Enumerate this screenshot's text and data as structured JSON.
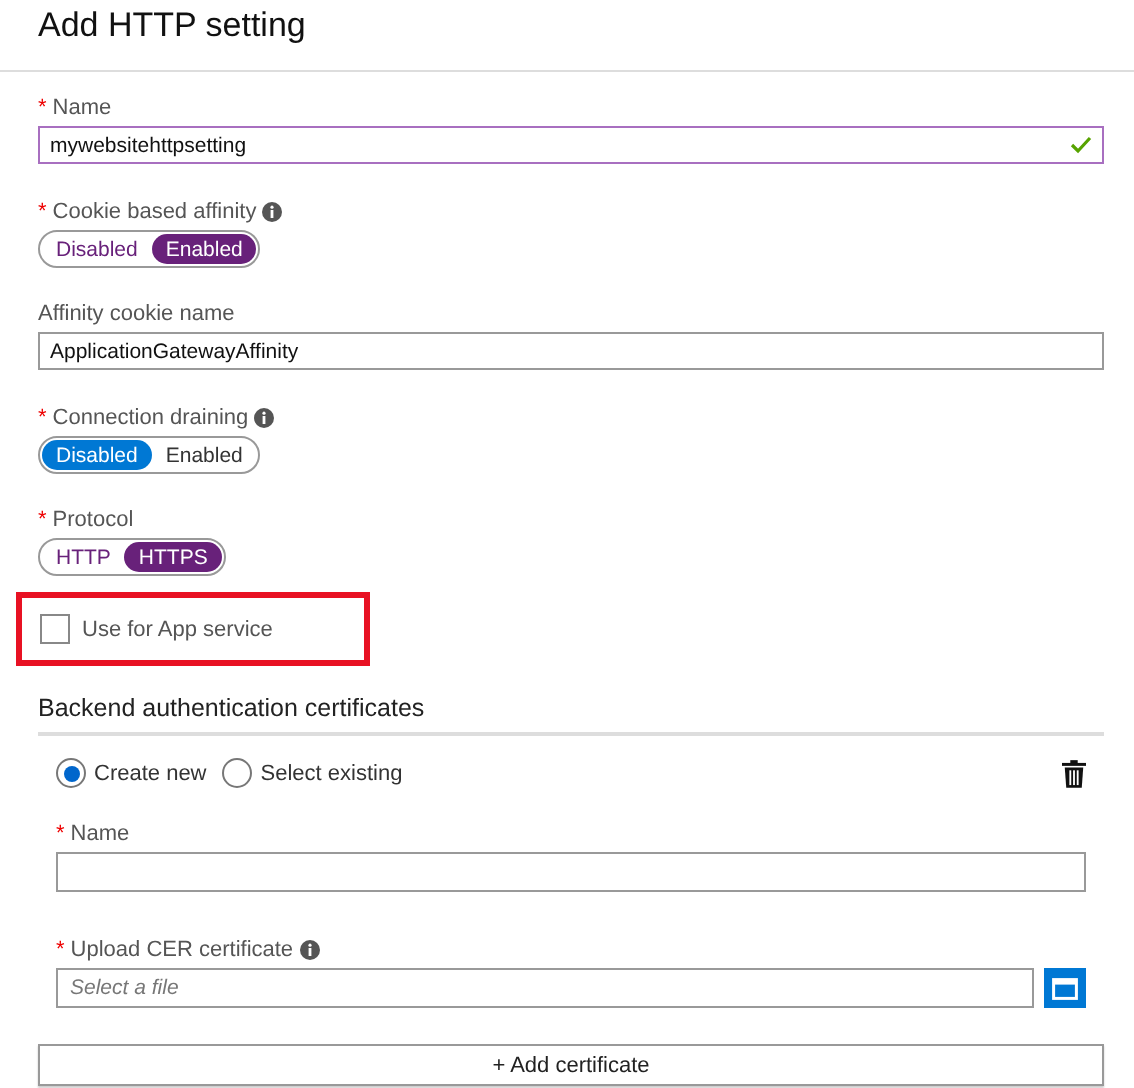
{
  "title": "Add HTTP setting",
  "fields": [
    {
      "kind": "text",
      "marker": "*",
      "label": "Name",
      "value": "mywebsitehttpsetting",
      "valid": true
    },
    {
      "kind": "toggle",
      "marker": "*",
      "label": "Cookie based affinity",
      "info": true,
      "color": "#68217a",
      "options": [
        {
          "label": "Disabled",
          "selected": false
        },
        {
          "label": "Enabled",
          "selected": true
        }
      ]
    },
    {
      "kind": "text",
      "label": "Affinity cookie name",
      "value": "ApplicationGatewayAffinity",
      "valid": false
    },
    {
      "kind": "toggle",
      "marker": "*",
      "label": "Connection draining",
      "info": true,
      "color": "#0078d4",
      "options": [
        {
          "label": "Disabled",
          "selected": true
        },
        {
          "label": "Enabled",
          "selected": false
        }
      ]
    },
    {
      "kind": "toggle",
      "marker": "*",
      "label": "Protocol",
      "color": "#68217a",
      "options": [
        {
          "label": "HTTP",
          "selected": false
        },
        {
          "label": "HTTPS",
          "selected": true
        }
      ]
    },
    {
      "kind": "checkbox",
      "label": "Use for App service",
      "checked": false,
      "highlighted": true
    }
  ],
  "backend": {
    "heading": "Backend authentication certificates",
    "radios": [
      {
        "label": "Create new",
        "selected": true
      },
      {
        "label": "Select existing",
        "selected": false
      }
    ],
    "name": {
      "marker": "*",
      "label": "Name"
    },
    "upload": {
      "marker": "*",
      "label": "Upload CER certificate",
      "info": true,
      "placeholder": "Select a file"
    },
    "add_button": "+ Add certificate"
  }
}
